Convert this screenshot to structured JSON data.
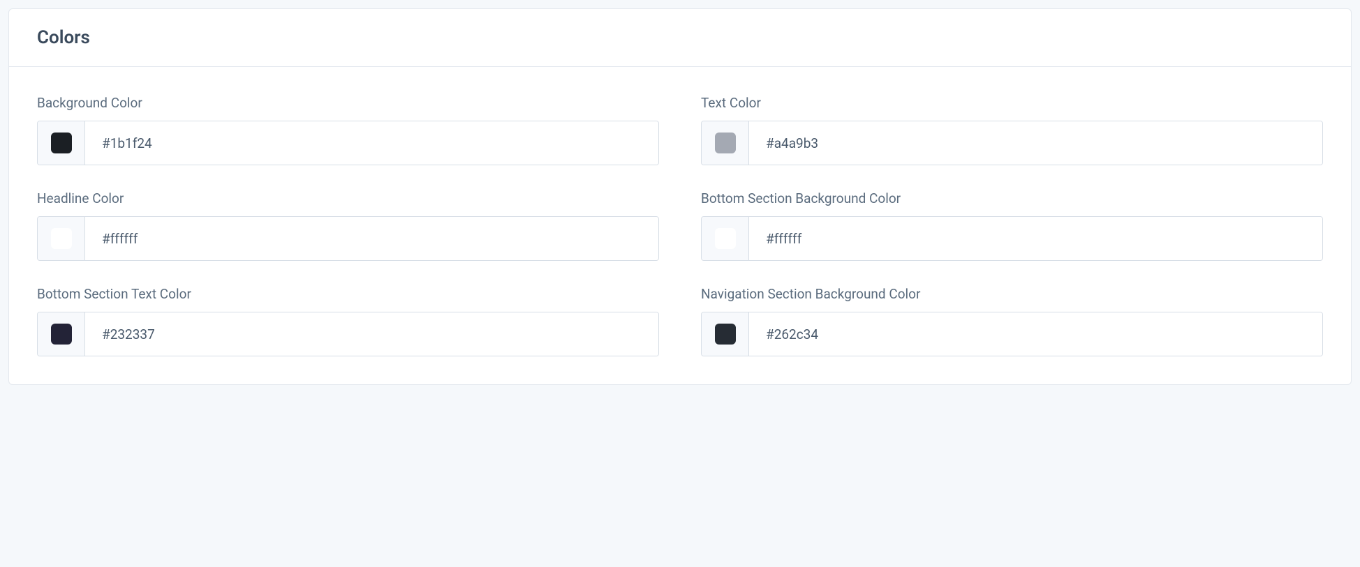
{
  "header": {
    "title": "Colors"
  },
  "fields": [
    {
      "label": "Background Color",
      "value": "#1b1f24",
      "swatch": "#1b1f24"
    },
    {
      "label": "Text Color",
      "value": "#a4a9b3",
      "swatch": "#a4a9b3"
    },
    {
      "label": "Headline Color",
      "value": "#ffffff",
      "swatch": "#ffffff"
    },
    {
      "label": "Bottom Section Background Color",
      "value": "#ffffff",
      "swatch": "#ffffff"
    },
    {
      "label": "Bottom Section Text Color",
      "value": "#232337",
      "swatch": "#232337"
    },
    {
      "label": "Navigation Section Background Color",
      "value": "#262c34",
      "swatch": "#262c34"
    }
  ]
}
